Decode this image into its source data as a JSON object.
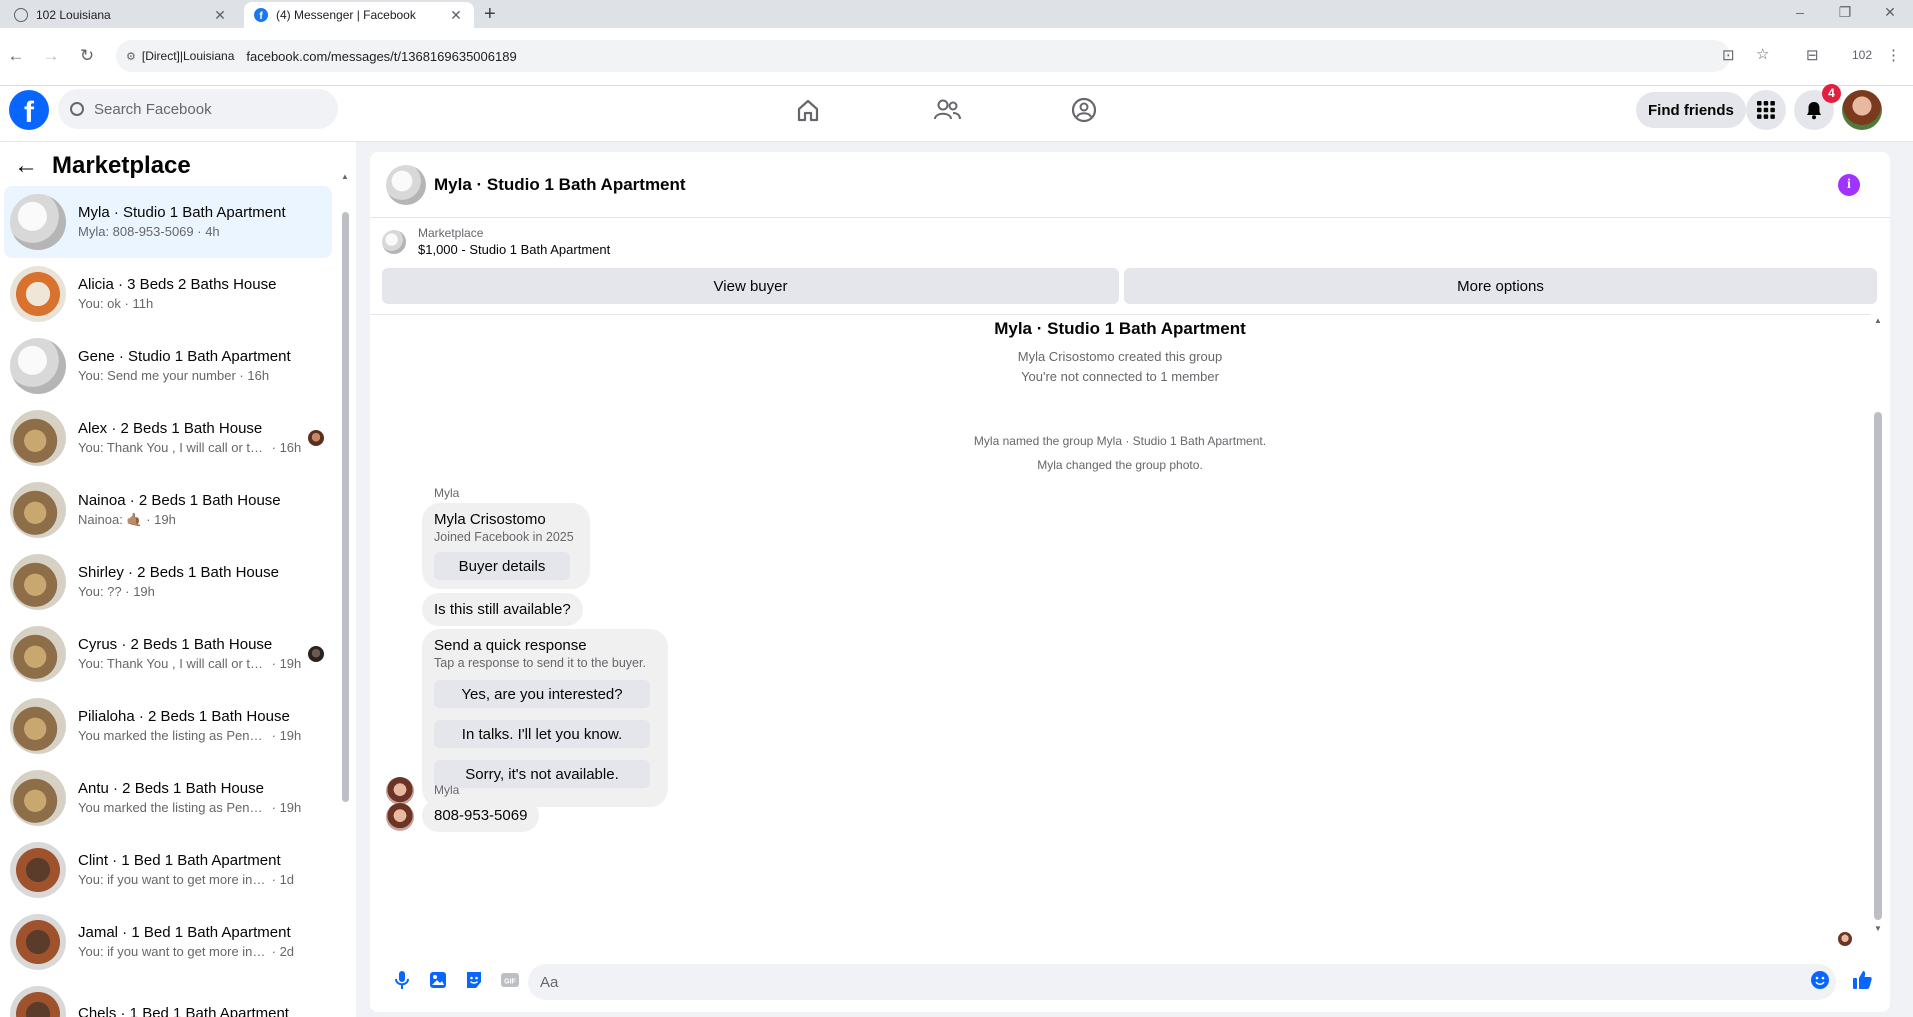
{
  "browser": {
    "tabs": [
      {
        "title": "102 Louisiana",
        "active": false
      },
      {
        "title": "(4) Messenger | Facebook",
        "active": true
      }
    ],
    "new_tab": "+",
    "window_controls": {
      "minimize": "–",
      "maximize": "❐",
      "close": "✕"
    },
    "nav": {
      "back": "←",
      "forward": "→",
      "reload": "↻"
    },
    "site_info_icon": "tune-icon",
    "address_chip": "[Direct]|Louisiana",
    "url": "facebook.com/messages/t/1368169635006189",
    "profile_label": "102",
    "menu": "⋮"
  },
  "facebook_header": {
    "logo": "f",
    "search_placeholder": "Search Facebook",
    "find_friends": "Find friends",
    "notifications_count": "4",
    "accent": "#0866ff"
  },
  "sidebar": {
    "back_icon": "←",
    "title": "Marketplace",
    "conversations": [
      {
        "name": "Myla · Studio 1 Bath Apartment",
        "snippet": "Myla: 808-953-5069",
        "time": "4h",
        "thumb": "white",
        "selected": true
      },
      {
        "name": "Alicia · 3 Beds 2 Baths House",
        "snippet": "You: ok",
        "time": "11h",
        "thumb": "orange"
      },
      {
        "name": "Gene · Studio 1 Bath Apartment",
        "snippet": "You: Send me your number",
        "time": "16h",
        "thumb": "white"
      },
      {
        "name": "Alex · 2 Beds 1 Bath House",
        "snippet": "You: Thank You , I will call or te...",
        "time": "16h",
        "thumb": "wood",
        "seen": true
      },
      {
        "name": "Nainoa · 2 Beds 1 Bath House",
        "snippet": "Nainoa: 🤙🏽",
        "time": "19h",
        "thumb": "wood"
      },
      {
        "name": "Shirley · 2 Beds 1 Bath House",
        "snippet": "You: ??",
        "time": "19h",
        "thumb": "wood"
      },
      {
        "name": "Cyrus · 2 Beds 1 Bath House",
        "snippet": "You: Thank You , I will call or te...",
        "time": "19h",
        "thumb": "wood",
        "seen": true
      },
      {
        "name": "Pilialoha · 2 Beds 1 Bath House",
        "snippet": "You marked the listing as Pending.",
        "time": "19h",
        "thumb": "wood"
      },
      {
        "name": "Antu · 2 Beds 1 Bath House",
        "snippet": "You marked the listing as Pending.",
        "time": "19h",
        "thumb": "wood"
      },
      {
        "name": "Clint · 1 Bed 1 Bath Apartment",
        "snippet": "You: if you want to get more inform...",
        "time": "1d",
        "thumb": "kitchen"
      },
      {
        "name": "Jamal · 1 Bed 1 Bath Apartment",
        "snippet": "You: if you want to get more inform...",
        "time": "2d",
        "thumb": "kitchen"
      },
      {
        "name": "Chels · 1 Bed 1 Bath Apartment",
        "snippet": "",
        "time": "",
        "thumb": "kitchen"
      }
    ]
  },
  "chat": {
    "title": "Myla · Studio 1 Bath Apartment",
    "info_icon": "i",
    "listing_label": "Marketplace",
    "listing_price_title": "$1,000 - Studio 1 Bath Apartment",
    "view_buyer": "View buyer",
    "more_options": "More options",
    "group_title": "Myla · Studio 1 Bath Apartment",
    "group_created": "Myla Crisostomo created this group",
    "group_not_connected": "You're not connected to 1 member",
    "sys_named": "Myla named the group Myla · Studio 1 Bath Apartment.",
    "sys_photo": "Myla changed the group photo.",
    "sender1": "Myla",
    "profile_card": {
      "name": "Myla Crisostomo",
      "joined": "Joined Facebook in 2025",
      "button": "Buyer details"
    },
    "msg_available": "Is this still available?",
    "quick": {
      "title": "Send a quick response",
      "subtitle": "Tap a response to send it to the buyer.",
      "options": [
        "Yes, are you interested?",
        "In talks. I'll let you know.",
        "Sorry, it's not available."
      ]
    },
    "sender2": "Myla",
    "msg_phone": "808-953-5069",
    "composer_placeholder": "Aa"
  }
}
